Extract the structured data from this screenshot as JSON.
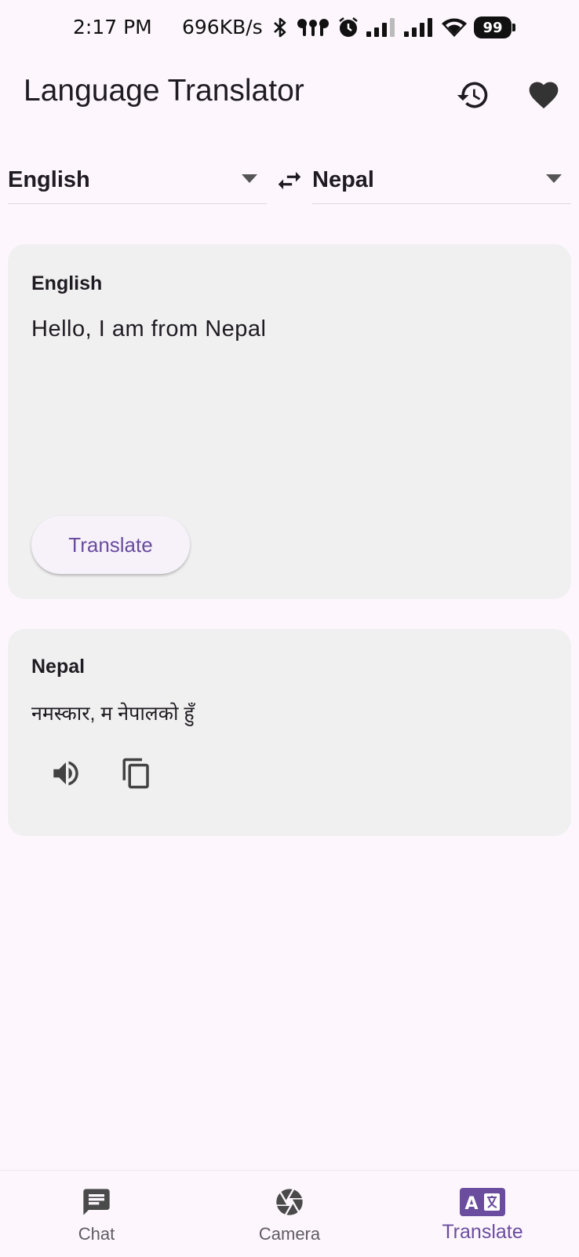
{
  "status": {
    "time": "2:17 PM",
    "speed": "696KB/s",
    "battery": "99",
    "icons": [
      "bluetooth-icon",
      "earbuds-icon",
      "alarm-icon",
      "signal-icon",
      "signal-icon",
      "wifi-icon",
      "battery-icon"
    ]
  },
  "header": {
    "title": "Language Translator",
    "icons": [
      "history-icon",
      "heart-icon"
    ]
  },
  "languages": {
    "source": "English",
    "target": "Nepal"
  },
  "input_card": {
    "title": "English",
    "text": "Hello, I am from Nepal",
    "button_label": "Translate"
  },
  "output_card": {
    "title": "Nepal",
    "text": "नमस्कार, म नेपालको हुँ",
    "icons": [
      "speaker-icon",
      "copy-icon"
    ]
  },
  "nav": {
    "items": [
      {
        "label": "Chat",
        "icon": "chat-icon"
      },
      {
        "label": "Camera",
        "icon": "camera-icon"
      },
      {
        "label": "Translate",
        "icon": "translate-icon"
      }
    ],
    "active": "Translate"
  },
  "colors": {
    "accent": "#6a4d9e",
    "background": "#fdf7fd",
    "card": "#f0f0f0",
    "icon": "#424242"
  }
}
